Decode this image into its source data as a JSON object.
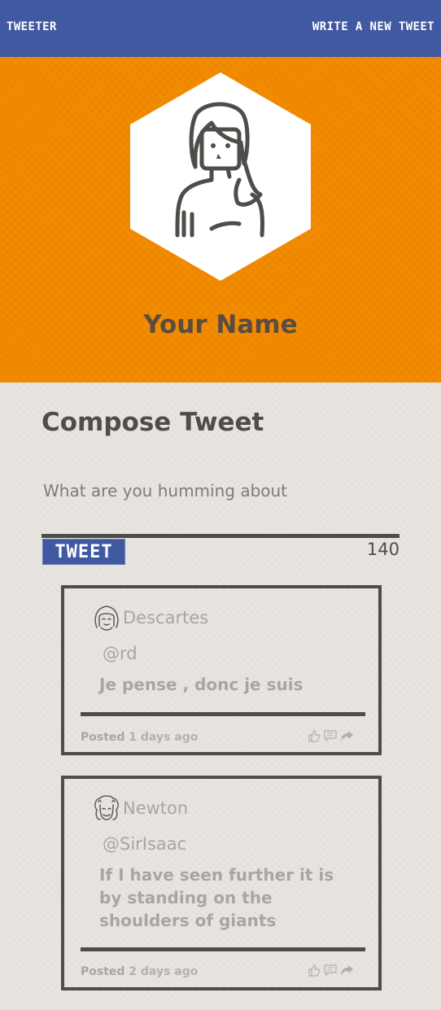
{
  "header": {
    "brand": "Tweeter",
    "write_link": "Write a new tweet"
  },
  "profile": {
    "name": "Your Name",
    "avatar_icon": "woman-avatar-icon"
  },
  "compose": {
    "title": "Compose Tweet",
    "placeholder": "What are you humming about",
    "button_label": "Tweet",
    "char_count": "140"
  },
  "tweets": [
    {
      "author": "Descartes",
      "avatar_icon": "descartes-avatar-icon",
      "handle": "@rd",
      "text": "Je pense , donc je suis",
      "posted_prefix": "Posted",
      "posted_age": "1 days ago"
    },
    {
      "author": "Newton",
      "avatar_icon": "newton-avatar-icon",
      "handle": "@SirIsaac",
      "text": "If I have seen further it is by standing on the shoulders of giants",
      "posted_prefix": "Posted",
      "posted_age": "2 days ago"
    }
  ],
  "action_icons": [
    "like-icon",
    "comment-icon",
    "retweet-icon"
  ],
  "colors": {
    "nav": "#4159a1",
    "hero": "#f38b00",
    "dark": "#4f4d4a",
    "muted_text": "#a8a6a3"
  }
}
